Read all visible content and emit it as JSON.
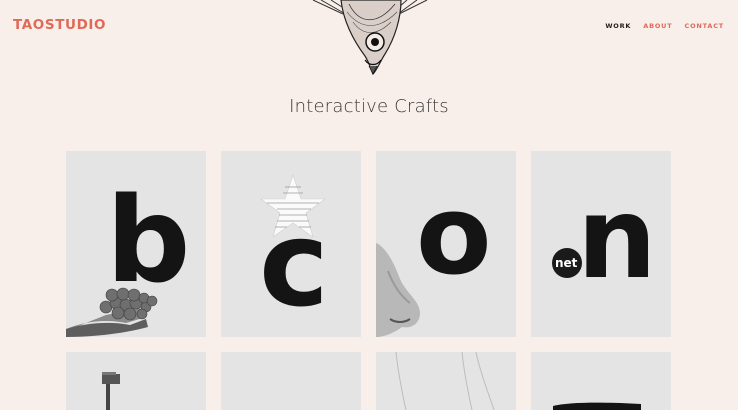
{
  "header": {
    "logo": "TAOSTUDIO",
    "nav": [
      {
        "label": "WORK",
        "active": true
      },
      {
        "label": "ABOUT",
        "active": false
      },
      {
        "label": "CONTACT",
        "active": false
      }
    ]
  },
  "page": {
    "title": "Interactive Crafts"
  },
  "grid": {
    "tiles": [
      {
        "letter": "b",
        "image": "hand-with-grapes"
      },
      {
        "letter": "c",
        "image": "text-star"
      },
      {
        "letter": "o",
        "image": "nose"
      },
      {
        "letter": "n",
        "image": "net-badge",
        "badge": "net"
      }
    ]
  },
  "colors": {
    "background": "#f9efea",
    "accent": "#df6a57",
    "tile": "#e4e4e4",
    "letter": "#141414"
  }
}
